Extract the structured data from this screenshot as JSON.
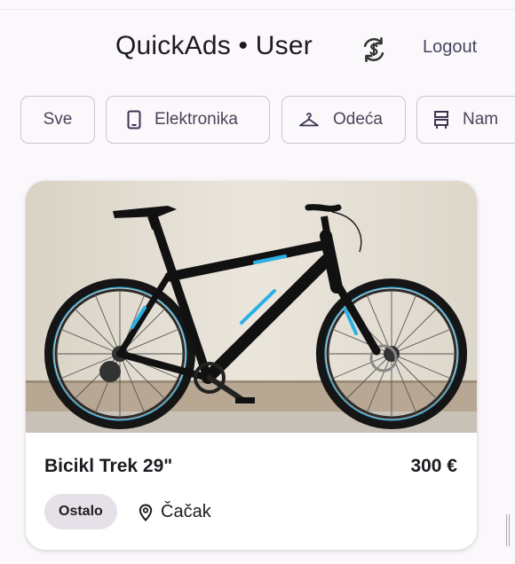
{
  "header": {
    "title": "QuickAds • User",
    "sync_icon": "sync-icon",
    "logout_label": "Logout"
  },
  "categories": [
    {
      "label": "Sve",
      "icon": null,
      "selected": false
    },
    {
      "label": "Elektronika",
      "icon": "phone-icon",
      "selected": false
    },
    {
      "label": "Odeća",
      "icon": "hanger-icon",
      "selected": false
    },
    {
      "label": "Nam",
      "icon": "furniture-icon",
      "selected": false
    }
  ],
  "ads": [
    {
      "title": "Bicikl Trek 29\"",
      "price": "300 €",
      "category": "Ostalo",
      "location": "Čačak",
      "location_icon": "location-pin-icon",
      "image": "bicycle-photo"
    }
  ],
  "colors": {
    "background": "#fbf8fc",
    "chip_border": "#c9c4cf",
    "badge_bg": "#e6e0e9",
    "text": "#1d1b20"
  }
}
